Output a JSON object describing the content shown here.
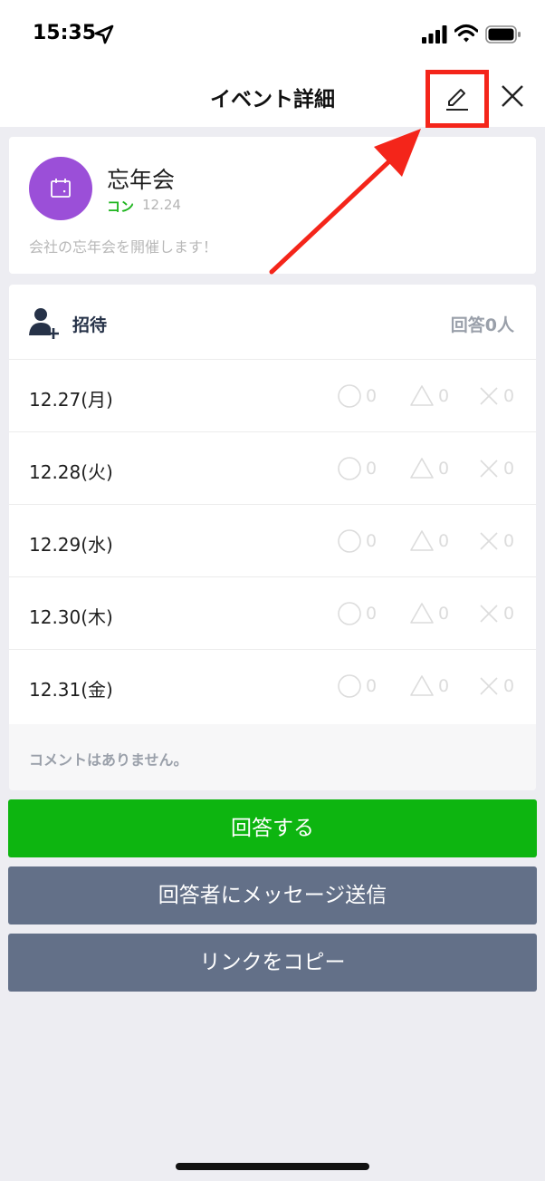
{
  "status_bar": {
    "time": "15:35",
    "icons": [
      "location-arrow-icon",
      "signal-icon",
      "wifi-icon",
      "battery-icon"
    ]
  },
  "nav": {
    "title": "イベント詳細",
    "edit_icon": "pencil-edit-icon",
    "close_icon": "close-icon",
    "highlight_color": "#f4251a"
  },
  "event": {
    "title": "忘年会",
    "author": "コン",
    "date": "12.24",
    "description": "会社の忘年会を開催します！",
    "avatar_icon": "calendar-icon",
    "avatar_color": "#9b4fd8"
  },
  "schedule": {
    "invite_label": "招待",
    "response_count": "回答0人",
    "dates": [
      {
        "label": "12.27(月)",
        "maru": "0",
        "sankaku": "0",
        "batsu": "0"
      },
      {
        "label": "12.28(火)",
        "maru": "0",
        "sankaku": "0",
        "batsu": "0"
      },
      {
        "label": "12.29(水)",
        "maru": "0",
        "sankaku": "0",
        "batsu": "0"
      },
      {
        "label": "12.30(木)",
        "maru": "0",
        "sankaku": "0",
        "batsu": "0"
      },
      {
        "label": "12.31(金)",
        "maru": "0",
        "sankaku": "0",
        "batsu": "0"
      }
    ],
    "comment": "コメントはありません。"
  },
  "buttons": {
    "answer": "回答する",
    "message": "回答者にメッセージ送信",
    "copy_link": "リンクをコピー"
  },
  "colors": {
    "answer_button": "#0db510",
    "secondary_button": "#637088",
    "author_green": "#1fb51f"
  }
}
